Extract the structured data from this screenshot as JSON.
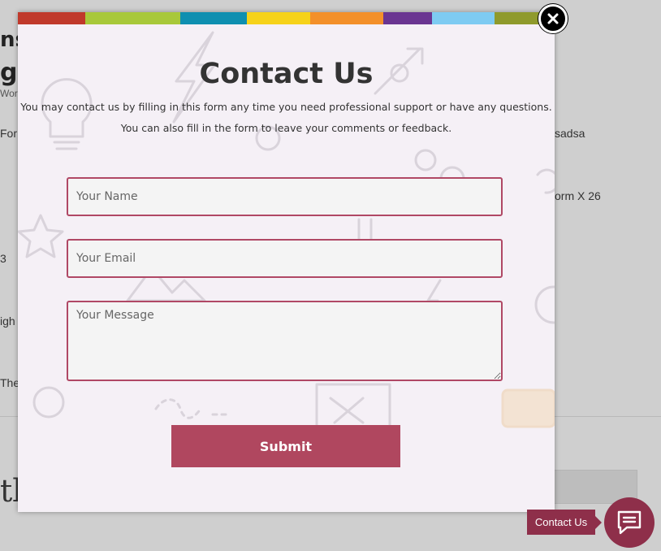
{
  "background": {
    "title_fragments": [
      "ns",
      "g"
    ],
    "subtitle_fragment": "Wor",
    "left_fragments": [
      "For",
      "3",
      "igh",
      "The"
    ],
    "right_fragments": [
      "sadsa",
      "orm X 26"
    ],
    "big_fragment": "tb"
  },
  "stripe_colors": [
    "#c0392b",
    "#a8c83a",
    "#0f8fb0",
    "#f6d21a",
    "#f3902a",
    "#6a3591",
    "#7ecbf2",
    "#8f9a2c"
  ],
  "modal": {
    "title": "Contact Us",
    "description_line1": "You may contact us by filling in this form any time you need professional support or have any questions.",
    "description_line2": "You can also fill in the form to leave your comments or feedback.",
    "fields": {
      "name_placeholder": "Your Name",
      "email_placeholder": "Your Email",
      "message_placeholder": "Your Message"
    },
    "submit_label": "Submit",
    "close_icon": "close-icon"
  },
  "widget": {
    "label": "Contact Us",
    "icon": "chat-icon"
  },
  "colors": {
    "accent": "#b0475f",
    "widget": "#8e2f4a",
    "modal_bg": "#f5f0f6"
  }
}
